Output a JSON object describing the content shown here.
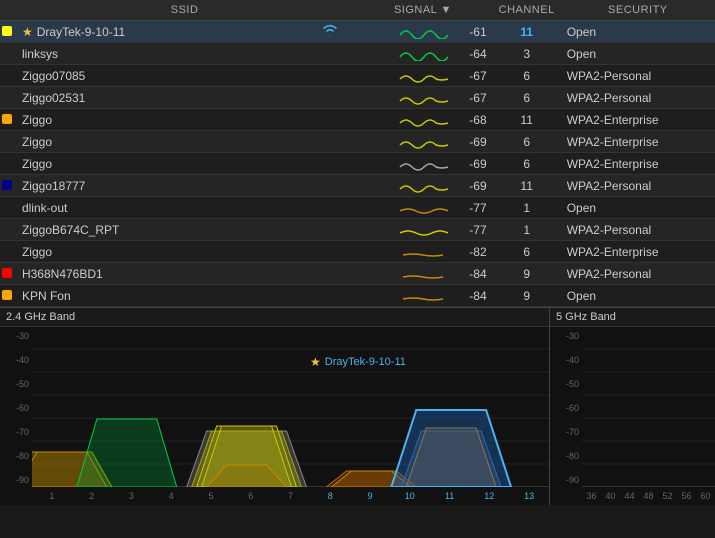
{
  "table": {
    "headers": [
      "SSID",
      "SIGNAL ▼",
      "CHANNEL",
      "SECURITY"
    ],
    "rows": [
      {
        "id": 0,
        "selected": true,
        "indicator": "yellow",
        "starred": true,
        "ssid": "DrayTek-9-10-11",
        "signal": -61,
        "signal_color": "#00cc44",
        "channel": "11",
        "channel_highlight": true,
        "security": "Open"
      },
      {
        "id": 1,
        "selected": false,
        "indicator": null,
        "starred": false,
        "ssid": "linksys",
        "signal": -64,
        "signal_color": "#00cc44",
        "channel": "3",
        "channel_highlight": false,
        "security": "Open"
      },
      {
        "id": 2,
        "selected": false,
        "indicator": null,
        "starred": false,
        "ssid": "Ziggo07085",
        "signal": -67,
        "signal_color": "#cccc00",
        "channel": "6",
        "channel_highlight": false,
        "security": "WPA2-Personal"
      },
      {
        "id": 3,
        "selected": false,
        "indicator": null,
        "starred": false,
        "ssid": "Ziggo02531",
        "signal": -67,
        "signal_color": "#cccc00",
        "channel": "6",
        "channel_highlight": false,
        "security": "WPA2-Personal"
      },
      {
        "id": 4,
        "selected": false,
        "indicator": "orange",
        "starred": false,
        "ssid": "Ziggo",
        "signal": -68,
        "signal_color": "#cccc00",
        "channel": "11",
        "channel_highlight": false,
        "security": "WPA2-Enterprise"
      },
      {
        "id": 5,
        "selected": false,
        "indicator": null,
        "starred": false,
        "ssid": "Ziggo",
        "signal": -69,
        "signal_color": "#cccc00",
        "channel": "6",
        "channel_highlight": false,
        "security": "WPA2-Enterprise"
      },
      {
        "id": 6,
        "selected": false,
        "indicator": null,
        "starred": false,
        "ssid": "Ziggo",
        "signal": -69,
        "signal_color": "#aaaaaa",
        "channel": "6",
        "channel_highlight": false,
        "security": "WPA2-Enterprise"
      },
      {
        "id": 7,
        "selected": false,
        "indicator": "darkblue",
        "starred": false,
        "ssid": "Ziggo18777",
        "signal": -69,
        "signal_color": "#cccc00",
        "channel": "11",
        "channel_highlight": false,
        "security": "WPA2-Personal"
      },
      {
        "id": 8,
        "selected": false,
        "indicator": null,
        "starred": false,
        "ssid": "dlink-out",
        "signal": -77,
        "signal_color": "#cc8800",
        "channel": "1",
        "channel_highlight": false,
        "security": "Open"
      },
      {
        "id": 9,
        "selected": false,
        "indicator": null,
        "starred": false,
        "ssid": "ZiggoB674C_RPT",
        "signal": -77,
        "signal_color": "#cccc00",
        "channel": "1",
        "channel_highlight": false,
        "security": "WPA2-Personal"
      },
      {
        "id": 10,
        "selected": false,
        "indicator": null,
        "starred": false,
        "ssid": "Ziggo",
        "signal": -82,
        "signal_color": "#cc8800",
        "channel": "6",
        "channel_highlight": false,
        "security": "WPA2-Enterprise"
      },
      {
        "id": 11,
        "selected": false,
        "indicator": "red",
        "starred": false,
        "ssid": "H368N476BD1",
        "signal": -84,
        "signal_color": "#cc8800",
        "channel": "9",
        "channel_highlight": false,
        "security": "WPA2-Personal"
      },
      {
        "id": 12,
        "selected": false,
        "indicator": "orange",
        "starred": false,
        "ssid": "KPN Fon",
        "signal": -84,
        "signal_color": "#cc8800",
        "channel": "9",
        "channel_highlight": false,
        "security": "Open"
      }
    ]
  },
  "chart24": {
    "title": "2.4 GHz Band",
    "network_label": "DrayTek-9-10-11",
    "y_labels": [
      "-30",
      "-40",
      "-50",
      "-60",
      "-70",
      "-80",
      "-90"
    ],
    "x_labels": [
      "1",
      "2",
      "3",
      "4",
      "5",
      "6",
      "7",
      "8",
      "9",
      "10",
      "11",
      "12",
      "13"
    ]
  },
  "chart5": {
    "title": "5 GHz Band",
    "y_labels": [
      "-30",
      "-40",
      "-50",
      "-60",
      "-70",
      "-80",
      "-90"
    ],
    "x_labels": [
      "36",
      "40",
      "44",
      "48",
      "52",
      "56",
      "60"
    ]
  }
}
